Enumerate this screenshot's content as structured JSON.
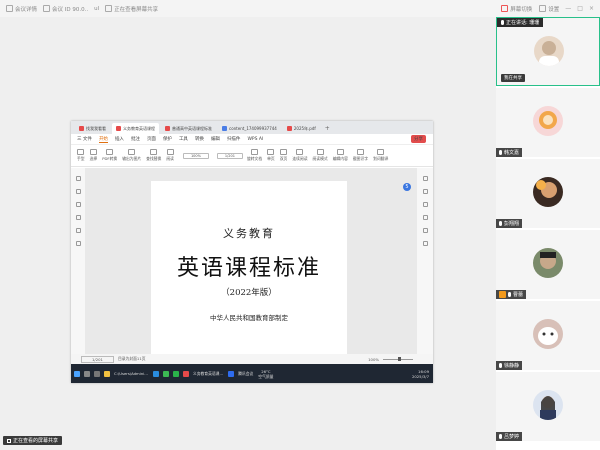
{
  "topbar": {
    "left_items": [
      "会议详情",
      "会议 ID 90.0..",
      "ul",
      "正在查看屏幕共享"
    ],
    "right_items": [
      "屏幕切换",
      "设置",
      "",
      "—",
      "□",
      "×"
    ]
  },
  "share_label": "正在查看的屏幕共享",
  "shared_window": {
    "tabs": [
      {
        "label": "找我我看看",
        "color": "#e64a4a"
      },
      {
        "label": "义务教育英语课程",
        "color": "#e64a4a"
      },
      {
        "label": "普通高中英语课程标准",
        "color": "#e64a4a"
      },
      {
        "label": "content_174099937744",
        "color": "#4a7de6"
      },
      {
        "label": "2025年.pdf",
        "color": "#e64a4a"
      }
    ],
    "menu": [
      "三 文件",
      "开始",
      "插入",
      "批注",
      "页面",
      "保护",
      "工具",
      "转换",
      "编辑",
      "扫描件",
      "WPS AI"
    ],
    "share_button": "分享",
    "ribbon": [
      "手型",
      "选择",
      "PDF转换",
      "输出为图片",
      "查找替换",
      "阅读",
      "旋转文档",
      "注释",
      "单页",
      "双页",
      "连续阅读",
      "阅读模式",
      "查找替换",
      "编辑内容",
      "插入文字",
      "截图识字",
      "划词翻译"
    ],
    "zoom_value": "100%",
    "page_value": "1/201",
    "document": {
      "line1": "义务教育",
      "line2": "英语课程标准",
      "line3": "（2022年版）",
      "line4": "中华人民共和国教育部制定"
    },
    "page_badge": "5",
    "status": {
      "page": "1/201",
      "note": "目录为封面11页",
      "zoom": "100%"
    },
    "taskbar": {
      "items": [
        "C:\\Users\\Admini...",
        "义务教育英语课...",
        "腾讯会议"
      ],
      "weather_temp": "26°C",
      "weather_text": "空气质量",
      "time": "16:09",
      "date": "2025/3/7"
    }
  },
  "participants": {
    "header": "正在讲话: 珊珊",
    "tiles": [
      {
        "name": "我",
        "extra": "我在共享",
        "sharing_label": "我在共享",
        "speaking": true
      },
      {
        "name": "韩文嘉",
        "speaking": false
      },
      {
        "name": "彭翔翔",
        "speaking": false
      },
      {
        "name": "曹蕾",
        "host": true,
        "speaking": false
      },
      {
        "name": "徐静静",
        "speaking": false
      },
      {
        "name": "吕梦婷",
        "speaking": false
      }
    ]
  },
  "colors": {
    "accent": "#28c08a",
    "host": "#f29a1d",
    "share_red": "#e24c4c"
  }
}
